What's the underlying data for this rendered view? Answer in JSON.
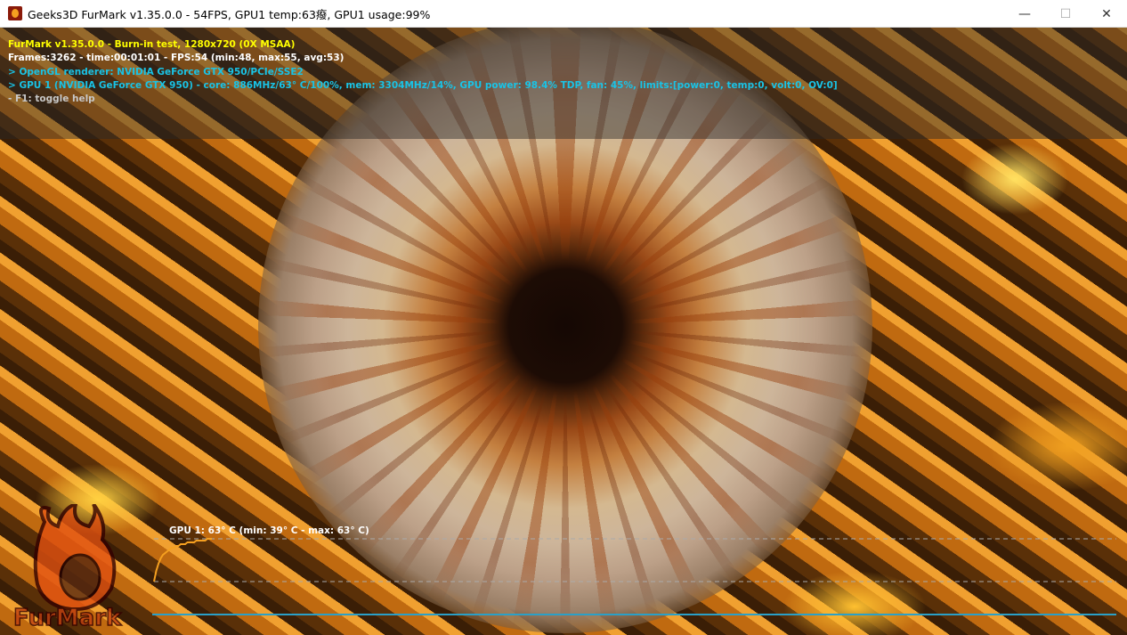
{
  "window": {
    "title": "Geeks3D FurMark v1.35.0.0 - 54FPS, GPU1 temp:63癈, GPU1 usage:99%",
    "minimize": "—",
    "maximize": "☐",
    "close": "✕"
  },
  "hud": {
    "line1": "FurMark v1.35.0.0 - Burn-in test, 1280x720 (0X MSAA)",
    "line2": "Frames:3262 - time:00:01:01 - FPS:54 (min:48, max:55, avg:53)",
    "line3": "> OpenGL renderer: NVIDIA GeForce GTX 950/PCIe/SSE2",
    "line4": "> GPU 1 (NVIDIA GeForce GTX 950) - core: 886MHz/63° C/100%, mem: 3304MHz/14%, GPU power: 98.4% TDP, fan: 45%, limits:[power:0, temp:0, volt:0, OV:0]",
    "line5": "- F1: toggle help",
    "colors": {
      "title": "#ffff00",
      "stats": "#ffffff",
      "info": "#19c3e6",
      "help": "#c8c8c8"
    }
  },
  "logo": {
    "text": "FurMark"
  },
  "temp_graph": {
    "label": "GPU 1: 63° C (min: 39° C - max: 63° C)",
    "min": 39,
    "max": 63,
    "samples": [
      39,
      45,
      49,
      52,
      54,
      55,
      56,
      57,
      58,
      58,
      59,
      59,
      60,
      60,
      60,
      61,
      61,
      61,
      61,
      62,
      62,
      62,
      62,
      62,
      63,
      63,
      63
    ]
  }
}
